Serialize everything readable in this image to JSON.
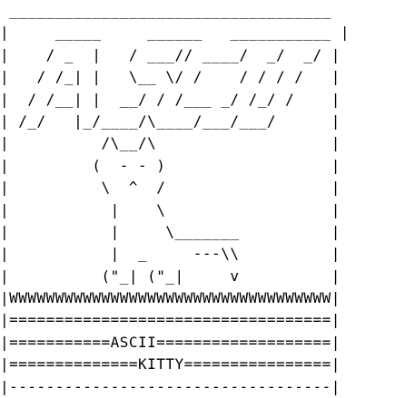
{
  "art": {
    "lines": [
      " ___________________________________",
      "|     _____     ______   ___________ |",
      "|    / _  |   / ___// ____/  _/  _/ |",
      "|   / /_| |   \\__ \\/ /    / / / /   |",
      "|  / /__| |  __/ / /___ _/ /_/ /    |",
      "| /_/   |_/____/\\____/___/___/      |",
      "|          /\\__/\\                   |",
      "|         (  - - )                  |",
      "|          \\  ^  /                  |",
      "|           |    \\                  |",
      "|           |     \\_______          |",
      "|           |  _     ---\\\\          |",
      "|          (\"_| (\"_|     v          |",
      "|WWWWWWWWWWWWWWWWWWWWWWWWWWWWWWWWWWW|",
      "|===================================|",
      "|===========ASCII===================|",
      "|==============KITTY================|",
      "|-----------------------------------|"
    ]
  }
}
